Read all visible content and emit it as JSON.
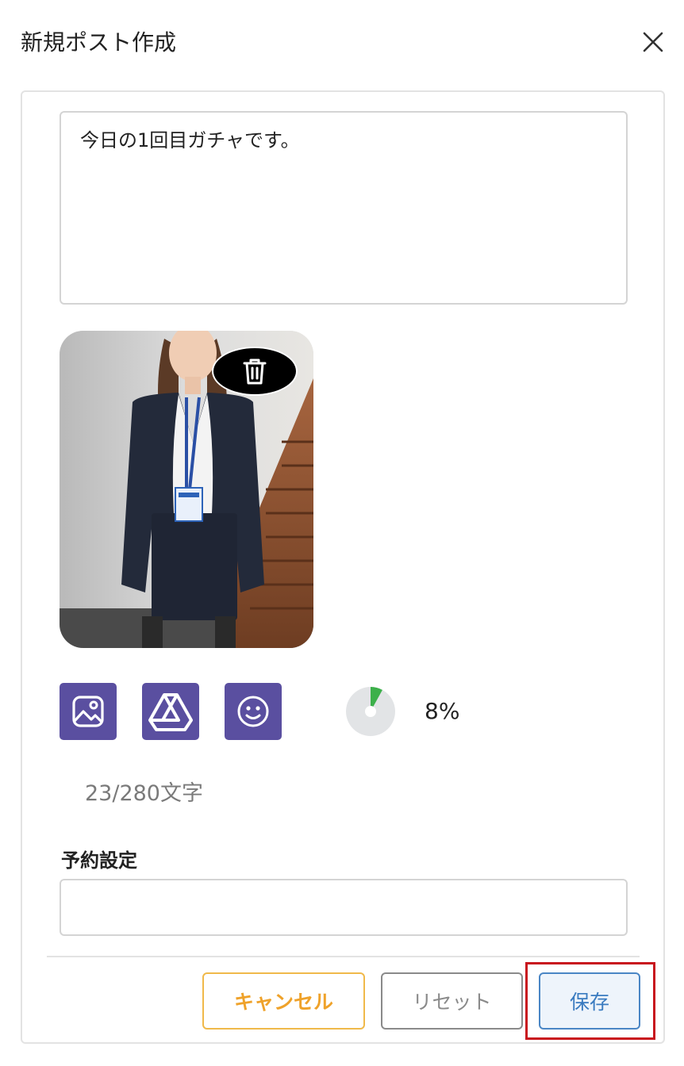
{
  "header": {
    "title": "新規ポスト作成"
  },
  "post": {
    "text": "今日の1回目ガチャです。"
  },
  "toolbar": {
    "progress_percent": 8,
    "progress_label": "8%"
  },
  "counter": {
    "text": "23/280文字"
  },
  "schedule": {
    "label": "予約設定",
    "value": ""
  },
  "footer": {
    "cancel_label": "キャンセル",
    "reset_label": "リセット",
    "save_label": "保存"
  },
  "colors": {
    "tool_button_bg": "#5a4fa0",
    "progress_fill": "#3cb04a",
    "progress_track": "#e2e4e6",
    "cancel": "#efa22a",
    "save": "#3a7bc0",
    "highlight": "#c8141e"
  },
  "icons": {
    "close": "close-icon",
    "delete": "trash-icon",
    "image": "image-icon",
    "drive": "google-drive-icon",
    "emoji": "smile-icon"
  }
}
